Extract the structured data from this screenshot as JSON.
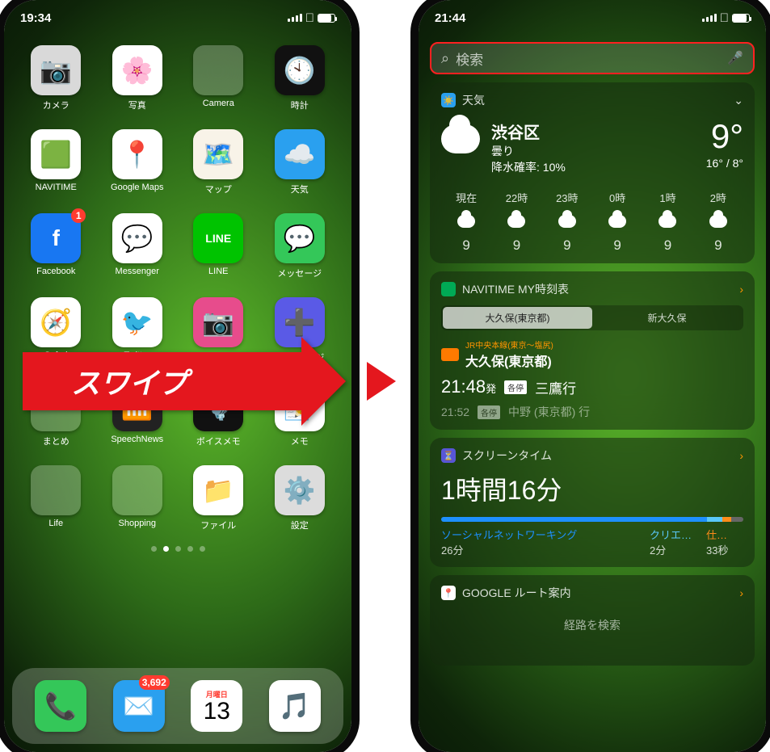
{
  "left": {
    "time": "19:34",
    "apps": [
      {
        "name": "カメラ",
        "bg": "#d9d9d9",
        "emoji": "📷"
      },
      {
        "name": "写真",
        "bg": "#fff",
        "emoji": "🌸"
      },
      {
        "name": "Camera",
        "bg": "#3b3b50",
        "emoji": "📱",
        "folder": true
      },
      {
        "name": "時計",
        "bg": "#111",
        "emoji": "🕙"
      },
      {
        "name": "NAVITIME",
        "bg": "#fff",
        "emoji": "🟩"
      },
      {
        "name": "Google Maps",
        "bg": "#fff",
        "emoji": "📍"
      },
      {
        "name": "マップ",
        "bg": "#f8f3e8",
        "emoji": "🗺️"
      },
      {
        "name": "天気",
        "bg": "#2aa0ef",
        "emoji": "☁️"
      },
      {
        "name": "Facebook",
        "bg": "#1877f2",
        "emoji": "f",
        "badge": "1",
        "txt": true
      },
      {
        "name": "Messenger",
        "bg": "#fff",
        "emoji": "💬"
      },
      {
        "name": "LINE",
        "bg": "#00c300",
        "emoji": "LINE",
        "txt": true,
        "fs": "14px"
      },
      {
        "name": "メッセージ",
        "bg": "#34c759",
        "emoji": "💬"
      },
      {
        "name": "Safari",
        "bg": "#fff",
        "emoji": "🧭"
      },
      {
        "name": "Twitter",
        "bg": "#fff",
        "emoji": "🐦"
      },
      {
        "name": "gram",
        "bg": "#e74c8c",
        "emoji": "📷"
      },
      {
        "name": "+メッセージ",
        "bg": "#5a5ae6",
        "emoji": "➕"
      },
      {
        "name": "まとめ",
        "bg": "#3b3b50",
        "folder": true
      },
      {
        "name": "SpeechNews",
        "bg": "#222",
        "emoji": "📶"
      },
      {
        "name": "ボイスメモ",
        "bg": "#111",
        "emoji": "🎙️"
      },
      {
        "name": "メモ",
        "bg": "#fff",
        "emoji": "📝"
      },
      {
        "name": "Life",
        "bg": "#3b3b50",
        "folder": true
      },
      {
        "name": "Shopping",
        "bg": "#3b3b50",
        "folder": true
      },
      {
        "name": "ファイル",
        "bg": "#fff",
        "emoji": "📁"
      },
      {
        "name": "設定",
        "bg": "#dcdcdc",
        "emoji": "⚙️"
      }
    ],
    "page_index": 1,
    "page_count": 5,
    "dock": [
      {
        "name": "phone",
        "bg": "#34c759",
        "emoji": "📞"
      },
      {
        "name": "mail",
        "bg": "#2aa0ef",
        "emoji": "✉️",
        "badge": "3,692"
      },
      {
        "name": "calendar",
        "day_label": "月曜日",
        "day_num": "13"
      },
      {
        "name": "music",
        "bg": "#fff",
        "emoji": "🎵"
      }
    ]
  },
  "swipe_label": "スワイプ",
  "right": {
    "time": "21:44",
    "search_placeholder": "検索",
    "weather": {
      "title": "天気",
      "location": "渋谷区",
      "cond": "曇り",
      "precip_label": "降水確率: 10%",
      "temp": "9°",
      "hilo": "16° / 8°",
      "hours": [
        {
          "t": "現在",
          "v": "9"
        },
        {
          "t": "22時",
          "v": "9"
        },
        {
          "t": "23時",
          "v": "9"
        },
        {
          "t": "0時",
          "v": "9"
        },
        {
          "t": "1時",
          "v": "9"
        },
        {
          "t": "2時",
          "v": "9"
        }
      ]
    },
    "navitime": {
      "title": "NAVITIME MY時刻表",
      "tabs": [
        "大久保(東京都)",
        "新大久保"
      ],
      "line": "JR中央本線(東京～塩尻)",
      "station": "大久保(東京都)",
      "dep_time": "21:48",
      "dep_suffix": "発",
      "dep_tag": "各停",
      "dep_dest": "三鷹行",
      "next_time": "21:52",
      "next_tag": "各停",
      "next_dest": "中野 (東京都) 行"
    },
    "screentime": {
      "title": "スクリーンタイム",
      "total": "1時間16分",
      "cats": [
        {
          "label": "ソーシャルネットワーキング",
          "val": "26分"
        },
        {
          "label": "クリエ…",
          "val": "2分"
        },
        {
          "label": "仕…",
          "val": "33秒"
        }
      ]
    },
    "google": {
      "title": "GOOGLE ルート案内",
      "sub": "経路を検索"
    }
  }
}
